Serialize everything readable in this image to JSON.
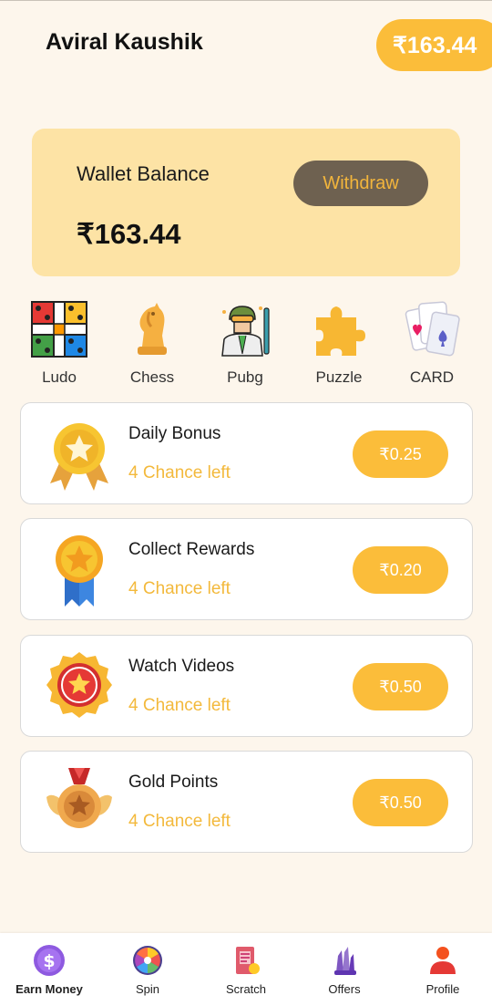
{
  "header": {
    "user_name": "Aviral Kaushik",
    "balance": "₹163.44"
  },
  "wallet": {
    "title": "Wallet Balance",
    "amount": "₹163.44",
    "withdraw_label": "Withdraw"
  },
  "games": [
    {
      "label": "Ludo",
      "icon": "ludo-board-icon"
    },
    {
      "label": "Chess",
      "icon": "chess-knight-icon"
    },
    {
      "label": "Pubg",
      "icon": "pubg-soldier-icon"
    },
    {
      "label": "Puzzle",
      "icon": "puzzle-piece-icon"
    },
    {
      "label": "CARD",
      "icon": "playing-cards-icon"
    }
  ],
  "rewards": [
    {
      "title": "Daily Bonus",
      "subtitle": "4 Chance left",
      "amount": "₹0.25",
      "icon": "star-medal-icon"
    },
    {
      "title": "Collect Rewards",
      "subtitle": "4 Chance left",
      "amount": "₹0.20",
      "icon": "ribbon-medal-icon"
    },
    {
      "title": "Watch Videos",
      "subtitle": "4 Chance left",
      "amount": "₹0.50",
      "icon": "star-badge-icon"
    },
    {
      "title": "Gold Points",
      "subtitle": "4 Chance left",
      "amount": "₹0.50",
      "icon": "winged-medal-icon"
    }
  ],
  "nav": [
    {
      "label": "Earn Money",
      "icon": "dollar-coin-icon",
      "active": true
    },
    {
      "label": "Spin",
      "icon": "spin-wheel-icon",
      "active": false
    },
    {
      "label": "Scratch",
      "icon": "scratch-card-icon",
      "active": false
    },
    {
      "label": "Offers",
      "icon": "crystal-gift-icon",
      "active": false
    },
    {
      "label": "Profile",
      "icon": "user-profile-icon",
      "active": false
    }
  ],
  "colors": {
    "background": "#fdf6ec",
    "accent": "#fbbd3a",
    "wallet_card": "#fde3a5",
    "withdraw_button": "#6e6150",
    "chance_text": "#f3b93c"
  }
}
